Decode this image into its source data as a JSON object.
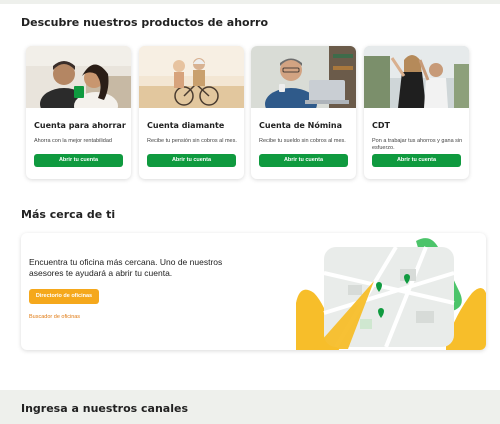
{
  "sections": {
    "products_title": "Descubre nuestros productos de ahorro",
    "near_title": "Más cerca de ti",
    "channels_title": "Ingresa a nuestros canales"
  },
  "products": [
    {
      "name": "Cuenta para ahorrar",
      "desc": "Ahorra con la mejor rentabilidad",
      "button": "Abrir tu cuenta"
    },
    {
      "name": "Cuenta diamante",
      "desc": "Recibe tu pensión sin cobros al mes.",
      "button": "Abrir tu cuenta"
    },
    {
      "name": "Cuenta de Nómina",
      "desc": "Recibe tu sueldo sin cobros al mes.",
      "button": "Abrir tu cuenta"
    },
    {
      "name": "CDT",
      "desc": "Pon a trabajar tus ahorros y gana sin esfuerzo.",
      "button": "Abrir tu cuenta"
    }
  ],
  "near": {
    "text": "Encuentra tu oficina más cercana. Uno de nuestros asesores te ayudará a abrir tu cuenta.",
    "button": "Directorio de oficinas",
    "link": "Buscador de oficinas"
  },
  "colors": {
    "primary_green": "#0f9a3f",
    "accent_orange": "#f5a81c",
    "link_orange": "#e07a12"
  }
}
